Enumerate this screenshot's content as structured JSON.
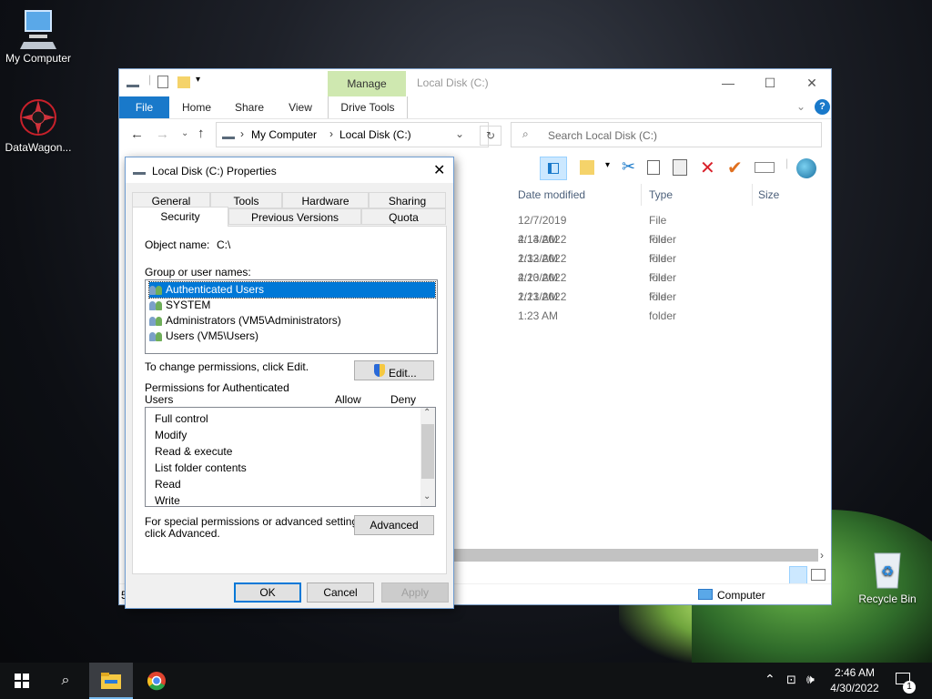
{
  "desktop": {
    "icons": [
      {
        "label": "My Computer",
        "icon": "computer-icon"
      },
      {
        "label": "DataWagon...",
        "icon": "datawagon-icon"
      },
      {
        "label": "Recycle Bin",
        "icon": "recycle-bin-icon"
      }
    ]
  },
  "explorer": {
    "title": "Local Disk (C:)",
    "manage_tab": "Manage",
    "ribbon_tabs": [
      "File",
      "Home",
      "Share",
      "View",
      "Drive Tools"
    ],
    "address": {
      "root": "My Computer",
      "current": "Local Disk (C:)"
    },
    "search_placeholder": "Search Local Disk (C:)",
    "columns": [
      "Date modified",
      "Type",
      "Size"
    ],
    "rows": [
      {
        "date": "12/7/2019 4:14 AM",
        "type": "File folder"
      },
      {
        "date": "2/13/2022 1:32 AM",
        "type": "File folder"
      },
      {
        "date": "2/13/2022 4:20 AM",
        "type": "File folder"
      },
      {
        "date": "2/13/2022 1:21 AM",
        "type": "File folder"
      },
      {
        "date": "2/13/2022 1:23 AM",
        "type": "File folder"
      }
    ],
    "status_left": "5",
    "status_location": "Computer"
  },
  "dialog": {
    "title": "Local Disk (C:) Properties",
    "tabs_row1": [
      "General",
      "Tools",
      "Hardware",
      "Sharing"
    ],
    "tabs_row2": [
      "Security",
      "Previous Versions",
      "Quota"
    ],
    "selected_tab": "Security",
    "object_name_label": "Object name:",
    "object_name_value": "C:\\",
    "group_label": "Group or user names:",
    "users": [
      "Authenticated Users",
      "SYSTEM",
      "Administrators (VM5\\Administrators)",
      "Users (VM5\\Users)"
    ],
    "change_text": "To change permissions, click Edit.",
    "edit_button": "Edit...",
    "permissions_for": "Permissions for Authenticated",
    "permissions_for_2": "Users",
    "allow_label": "Allow",
    "deny_label": "Deny",
    "permissions": [
      "Full control",
      "Modify",
      "Read & execute",
      "List folder contents",
      "Read",
      "Write"
    ],
    "special_text_1": "For special permissions or advanced settings,",
    "special_text_2": "click Advanced.",
    "advanced_button": "Advanced",
    "ok_button": "OK",
    "cancel_button": "Cancel",
    "apply_button": "Apply"
  },
  "taskbar": {
    "time": "2:46 AM",
    "date": "4/30/2022",
    "notification_count": "1"
  },
  "colors": {
    "accent": "#0078d7",
    "file_tab": "#1979ca",
    "manage_tab": "#cfe8b0",
    "taskbar": "#101214"
  }
}
